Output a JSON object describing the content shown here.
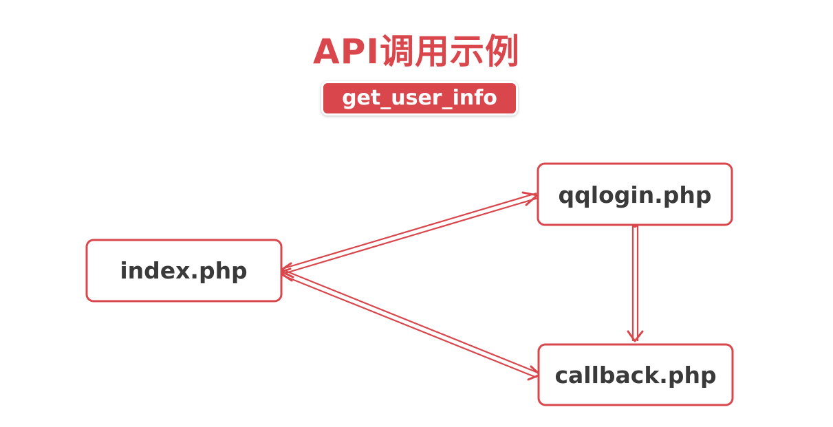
{
  "title": "API调用示例",
  "badge": "get_user_info",
  "nodes": {
    "index": "index.php",
    "qqlogin": "qqlogin.php",
    "callback": "callback.php"
  },
  "colors": {
    "accent": "#d9474d",
    "text": "#3a3a3a",
    "background": "#ffffff"
  }
}
